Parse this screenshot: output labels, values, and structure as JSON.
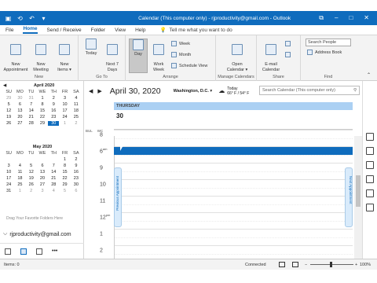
{
  "title": {
    "text": "Calendar (This computer only) - rjproductivity@gmail.com - Outlook",
    "minimize": "–",
    "maximize": "□",
    "close": "✕",
    "ribbon_toggle": "⧉"
  },
  "tabs": [
    {
      "label": "File"
    },
    {
      "label": "Home"
    },
    {
      "label": "Send / Receive"
    },
    {
      "label": "Folder"
    },
    {
      "label": "View"
    },
    {
      "label": "Help"
    }
  ],
  "tellme": "Tell me what you want to do",
  "ribbon": {
    "new_appointment": "New\nAppointment",
    "new_meeting": "New\nMeeting",
    "new_items": "New\nItems ▾",
    "new_group": "New",
    "today": "Today",
    "next7": "Next 7\nDays",
    "goto_group": "Go To",
    "day": "Day",
    "work_week": "Work\nWeek",
    "week": "Week",
    "month": "Month",
    "schedule_view": "Schedule View",
    "arrange_group": "Arrange",
    "open_calendar": "Open\nCalendar ▾",
    "manage_group": "Manage Calendars",
    "email_calendar": "E-mail\nCalendar",
    "share_group": "Share",
    "search_people": "Search People",
    "address_book": "Address Book",
    "find_group": "Find"
  },
  "mini_cal": [
    {
      "month": "April 2020",
      "days_head": [
        "SU",
        "MO",
        "TU",
        "WE",
        "TH",
        "FR",
        "SA"
      ],
      "weeks": [
        [
          "29",
          "30",
          "31",
          "1",
          "2",
          "3",
          "4"
        ],
        [
          "5",
          "6",
          "7",
          "8",
          "9",
          "10",
          "11"
        ],
        [
          "12",
          "13",
          "14",
          "15",
          "16",
          "17",
          "18"
        ],
        [
          "19",
          "20",
          "21",
          "22",
          "23",
          "24",
          "25"
        ],
        [
          "26",
          "27",
          "28",
          "29",
          "30",
          "1",
          "2"
        ]
      ]
    },
    {
      "month": "May 2020",
      "days_head": [
        "SU",
        "MO",
        "TU",
        "WE",
        "TH",
        "FR",
        "SA"
      ],
      "weeks": [
        [
          "",
          "",
          "",
          "",
          "",
          "1",
          "2"
        ],
        [
          "3",
          "4",
          "5",
          "6",
          "7",
          "8",
          "9"
        ],
        [
          "10",
          "11",
          "12",
          "13",
          "14",
          "15",
          "16"
        ],
        [
          "17",
          "18",
          "19",
          "20",
          "21",
          "22",
          "23"
        ],
        [
          "24",
          "25",
          "26",
          "27",
          "28",
          "29",
          "30"
        ],
        [
          "31",
          "1",
          "2",
          "3",
          "4",
          "5",
          "6"
        ]
      ]
    }
  ],
  "favorites_hint": "Drag Your Favorite Folders Here",
  "account": "rjproductivity@gmail.com",
  "calendar": {
    "date_title": "April 30, 2020",
    "location": "Washington, D.C. ▾",
    "weather_label": "Today",
    "weather_temp": "66° F / 54° F",
    "search_placeholder": "Search Calendar (This computer only)",
    "day_name": "THURSDAY",
    "day_number": "30",
    "tz1": "BUL",
    "tz2": "WC",
    "hours": [
      "8",
      "6",
      "9",
      "10",
      "11",
      "12",
      "1",
      "2"
    ],
    "hour_suffix": [
      "",
      "am",
      "",
      "",
      "",
      "pm",
      "",
      ""
    ],
    "prev_appt": "Previous Appointment",
    "next_appt": "Next Appointment"
  },
  "status": {
    "items": "Items: 0",
    "connected": "Connected",
    "zoom": "100%"
  },
  "colors": {
    "accent": "#0f6cbd",
    "day_header": "#abd0f3"
  }
}
